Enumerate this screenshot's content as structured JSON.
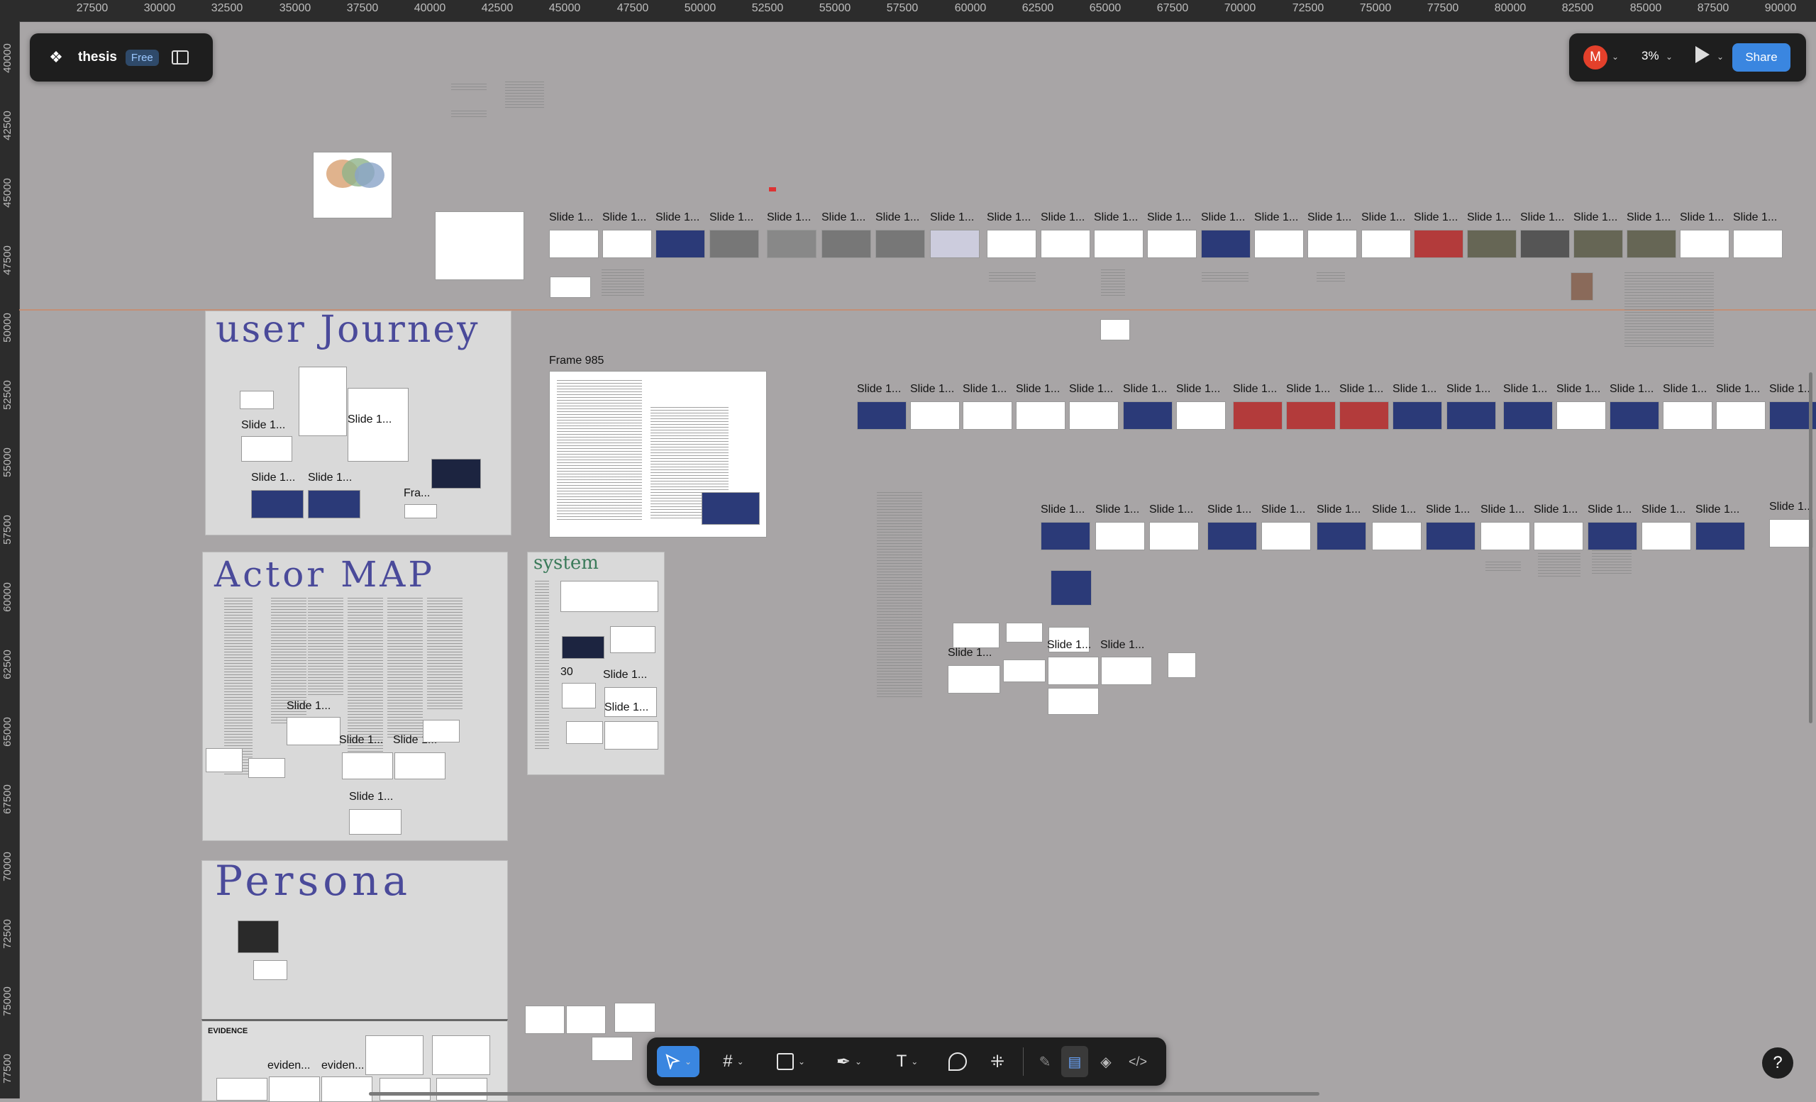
{
  "ruler": {
    "top_ticks": [
      "27500",
      "30000",
      "32500",
      "35000",
      "37500",
      "40000",
      "42500",
      "45000",
      "47500",
      "50000",
      "52500",
      "55000",
      "57500",
      "60000",
      "62500",
      "65000",
      "67500",
      "70000",
      "72500",
      "75000",
      "77500",
      "80000",
      "82500",
      "85000",
      "87500",
      "90000"
    ],
    "left_ticks": [
      "40000",
      "42500",
      "45000",
      "47500",
      "50000",
      "52500",
      "55000",
      "57500",
      "60000",
      "62500",
      "65000",
      "67500",
      "70000",
      "72500",
      "75000",
      "77500"
    ]
  },
  "file": {
    "name": "thesis",
    "plan_badge": "Free",
    "logo_icon": "figma-logo-icon",
    "sidebar_icon": "sidebar-toggle-icon"
  },
  "top_right": {
    "avatar_initial": "M",
    "avatar_color": "#e3402b",
    "zoom": "3%",
    "share_label": "Share",
    "accent": "#3a86e0"
  },
  "sections": {
    "user_journey": {
      "title": "user Journey"
    },
    "actor_map": {
      "title": "Actor MAP"
    },
    "system": {
      "title": "system"
    },
    "persona": {
      "title": "Persona"
    },
    "evidence": {
      "title": "EVIDENCE"
    }
  },
  "frame_985": {
    "title": "Frame 985"
  },
  "labels": {
    "slide": "Slide 1...",
    "fra": "Fra...",
    "thirty": "30",
    "eviden": "eviden..."
  },
  "toolbar": {
    "tools": [
      "move-tool-icon",
      "frame-tool-icon",
      "shape-tool-icon",
      "pen-tool-icon",
      "text-tool-icon",
      "comment-tool-icon",
      "actions-icon"
    ],
    "right_tools": [
      "draw-mode-icon",
      "design-mode-icon",
      "components-icon",
      "dev-mode-icon"
    ]
  },
  "help": {
    "label": "?"
  }
}
